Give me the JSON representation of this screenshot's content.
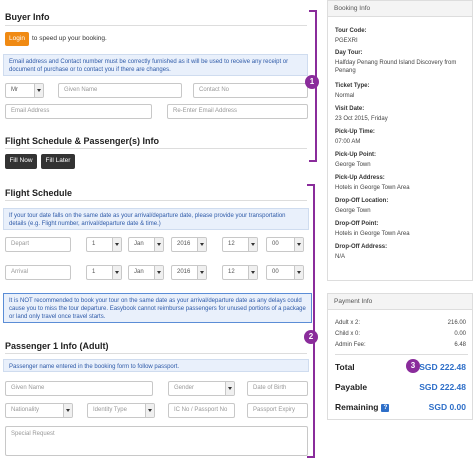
{
  "buyer_info": {
    "title": "Buyer Info",
    "login_button": "Login",
    "login_hint": "to speed up your booking.",
    "notice": "Email address and Contact number must be correctly furnished as it will be used to receive any receipt or document of purchase or to contact you if there are changes.",
    "title_select": "Mr",
    "given_name_placeholder": "Given Name",
    "contact_placeholder": "Contact No",
    "email_placeholder": "Email Address",
    "reemail_placeholder": "Re-Enter Email Address"
  },
  "flight_passenger": {
    "title": "Flight Schedule & Passenger(s) Info",
    "fill_now": "Fill Now",
    "fill_later": "Fill Later"
  },
  "flight_schedule": {
    "title": "Flight Schedule",
    "notice": "If your tour date falls on the same date as your arrival/departure date, please provide your transportation details (e.g. Flight number, arrival/departure date & time.)",
    "depart": {
      "label": "Depart",
      "day": "1",
      "month": "Jan",
      "year": "2016",
      "hour": "12",
      "minute": "00"
    },
    "arrival": {
      "label": "Arrival",
      "day": "1",
      "month": "Jan",
      "year": "2016",
      "hour": "12",
      "minute": "00"
    },
    "warning": "It is NOT recommended to book your tour on the same date as your arrival/departure date as any delays could cause you to miss the tour departure. Easybook cannot reimburse passengers for unused portions of a package or land only travel once travel starts."
  },
  "passenger": {
    "title": "Passenger 1 Info (Adult)",
    "notice": "Passenger name entered in the booking form to follow passport.",
    "given_name": "Given Name",
    "gender": "Gender",
    "dob": "Date of Birth",
    "nationality": "Nationality",
    "id_type": "Identity Type",
    "ic_no": "IC No / Passport No",
    "passport_expiry": "Passport Expiry",
    "special_request": "Special Request"
  },
  "markers": {
    "m1": "1",
    "m2": "2",
    "m3": "3"
  },
  "booking_info": {
    "title": "Booking Info",
    "items": [
      {
        "label": "Tour Code:",
        "value": "PGEXRI"
      },
      {
        "label": "Day Tour:",
        "value": "Halfday Penang Round Island Discovery from Penang"
      },
      {
        "label": "Ticket Type:",
        "value": "Normal"
      },
      {
        "label": "Visit Date:",
        "value": "23 Oct 2015, Friday"
      },
      {
        "label": "Pick-Up Time:",
        "value": "07:00 AM"
      },
      {
        "label": "Pick-Up Point:",
        "value": "George Town"
      },
      {
        "label": "Pick-Up Address:",
        "value": "Hotels in George Town Area"
      },
      {
        "label": "Drop-Off Location:",
        "value": "George Town"
      },
      {
        "label": "Drop-Off Point:",
        "value": "Hotels in George Town Area"
      },
      {
        "label": "Drop-Off Address:",
        "value": "N/A"
      }
    ]
  },
  "payment_info": {
    "title": "Payment Info",
    "rows": [
      {
        "label": "Adult x 2:",
        "value": "216.00"
      },
      {
        "label": "Child x 0:",
        "value": "0.00"
      },
      {
        "label": "Admin Fee:",
        "value": "6.48"
      }
    ],
    "total_label": "Total",
    "total_value": "SGD 222.48",
    "payable_label": "Payable",
    "payable_value": "SGD 222.48",
    "remaining_label": "Remaining",
    "remaining_value": "SGD 0.00",
    "help_icon": "?"
  },
  "colors": {
    "accent_orange": "#f08a13",
    "marker_purple": "#8a2c9b",
    "link_blue": "#2e6fc8"
  }
}
